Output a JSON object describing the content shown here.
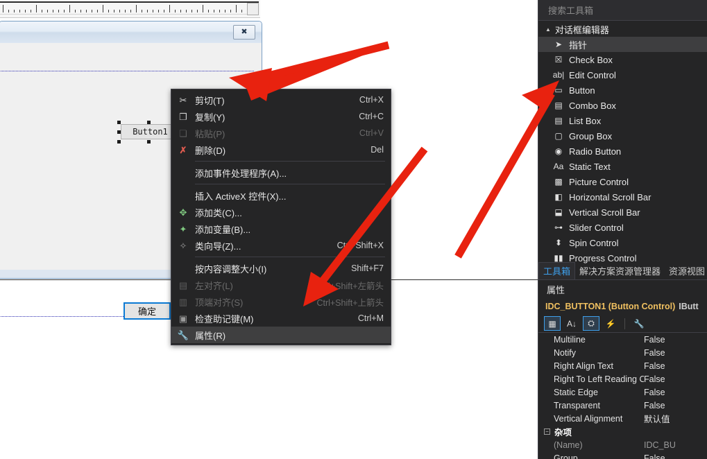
{
  "editor": {
    "dialog_close_glyph": "✖",
    "button1_label": "Button1",
    "ok_label": "确定"
  },
  "context_menu": {
    "items": [
      {
        "icon": "cut-icon",
        "glyph": "✂",
        "label": "剪切(T)",
        "shortcut": "Ctrl+X",
        "state": "normal"
      },
      {
        "icon": "copy-icon",
        "glyph": "❐",
        "label": "复制(Y)",
        "shortcut": "Ctrl+C",
        "state": "normal"
      },
      {
        "icon": "paste-icon",
        "glyph": "❏",
        "label": "粘贴(P)",
        "shortcut": "Ctrl+V",
        "state": "disabled"
      },
      {
        "icon": "delete-icon",
        "glyph": "✗",
        "label": "删除(D)",
        "shortcut": "Del",
        "state": "normal"
      },
      {
        "separator": true
      },
      {
        "icon": "none",
        "glyph": "",
        "label": "添加事件处理程序(A)...",
        "shortcut": "",
        "state": "normal"
      },
      {
        "separator": true
      },
      {
        "icon": "none",
        "glyph": "",
        "label": "插入 ActiveX 控件(X)...",
        "shortcut": "",
        "state": "normal"
      },
      {
        "icon": "add-class-icon",
        "glyph": "✥",
        "label": "添加类(C)...",
        "shortcut": "",
        "state": "normal"
      },
      {
        "icon": "add-variable-icon",
        "glyph": "✦",
        "label": "添加变量(B)...",
        "shortcut": "",
        "state": "normal"
      },
      {
        "icon": "class-wizard-icon",
        "glyph": "✧",
        "label": "类向导(Z)...",
        "shortcut": "Ctrl+Shift+X",
        "state": "normal"
      },
      {
        "separator": true
      },
      {
        "icon": "none",
        "glyph": "",
        "label": "按内容调整大小(I)",
        "shortcut": "Shift+F7",
        "state": "normal"
      },
      {
        "icon": "align-left-icon",
        "glyph": "▤",
        "label": "左对齐(L)",
        "shortcut": "Ctrl+Shift+左箭头",
        "state": "disabled"
      },
      {
        "icon": "align-top-icon",
        "glyph": "▥",
        "label": "顶端对齐(S)",
        "shortcut": "Ctrl+Shift+上箭头",
        "state": "disabled"
      },
      {
        "icon": "check-mnemonic-icon",
        "glyph": "▣",
        "label": "检查助记键(M)",
        "shortcut": "Ctrl+M",
        "state": "normal"
      },
      {
        "icon": "properties-wrench-icon",
        "glyph": "🔧",
        "label": "属性(R)",
        "shortcut": "",
        "state": "highlighted"
      }
    ]
  },
  "toolbox": {
    "search_placeholder": "搜索工具箱",
    "group_label": "对话框编辑器",
    "items": [
      {
        "icon": "pointer-icon",
        "glyph": "➤",
        "label": "指针",
        "selected": true
      },
      {
        "icon": "check-box-icon",
        "glyph": "☒",
        "label": "Check Box",
        "selected": false
      },
      {
        "icon": "edit-control-icon",
        "glyph": "ab|",
        "label": "Edit Control",
        "selected": false
      },
      {
        "icon": "button-icon",
        "glyph": "▭",
        "label": "Button",
        "selected": false
      },
      {
        "icon": "combo-box-icon",
        "glyph": "▤",
        "label": "Combo Box",
        "selected": false
      },
      {
        "icon": "list-box-icon",
        "glyph": "▤",
        "label": "List Box",
        "selected": false
      },
      {
        "icon": "group-box-icon",
        "glyph": "▢",
        "label": "Group Box",
        "selected": false
      },
      {
        "icon": "radio-button-icon",
        "glyph": "◉",
        "label": "Radio Button",
        "selected": false
      },
      {
        "icon": "static-text-icon",
        "glyph": "Aa",
        "label": "Static Text",
        "selected": false
      },
      {
        "icon": "picture-control-icon",
        "glyph": "▩",
        "label": "Picture Control",
        "selected": false
      },
      {
        "icon": "horizontal-scroll-bar-icon",
        "glyph": "◧",
        "label": "Horizontal Scroll Bar",
        "selected": false
      },
      {
        "icon": "vertical-scroll-bar-icon",
        "glyph": "⬓",
        "label": "Vertical Scroll Bar",
        "selected": false
      },
      {
        "icon": "slider-control-icon",
        "glyph": "⊶",
        "label": "Slider Control",
        "selected": false
      },
      {
        "icon": "spin-control-icon",
        "glyph": "⬍",
        "label": "Spin Control",
        "selected": false
      },
      {
        "icon": "progress-control-icon",
        "glyph": "▮▮",
        "label": "Progress Control",
        "selected": false
      }
    ],
    "tabs": [
      {
        "label": "工具箱",
        "active": true
      },
      {
        "label": "解决方案资源管理器",
        "active": false
      },
      {
        "label": "资源视图",
        "active": false
      }
    ]
  },
  "properties": {
    "panel_title": "属性",
    "object_name": "IDC_BUTTON1 (Button Control)",
    "object_type": "IButt",
    "toolbar": [
      {
        "icon": "categorized-icon",
        "glyph": "▦",
        "active": true
      },
      {
        "icon": "alphabetical-icon",
        "glyph": "A↓",
        "active": false
      },
      {
        "icon": "property-pages-icon",
        "glyph": "⛭",
        "active": true
      },
      {
        "icon": "events-icon",
        "glyph": "⚡",
        "active": false
      },
      {
        "icon": "wrench-icon",
        "glyph": "🔧",
        "active": false
      }
    ],
    "rows": [
      {
        "name": "Multiline",
        "value": "False",
        "kind": "prop"
      },
      {
        "name": "Notify",
        "value": "False",
        "kind": "prop"
      },
      {
        "name": "Right Align Text",
        "value": "False",
        "kind": "prop"
      },
      {
        "name": "Right To Left Reading Order",
        "value": "False",
        "kind": "prop"
      },
      {
        "name": "Static Edge",
        "value": "False",
        "kind": "prop"
      },
      {
        "name": "Transparent",
        "value": "False",
        "kind": "prop"
      },
      {
        "name": "Vertical Alignment",
        "value": "默认值",
        "kind": "prop"
      },
      {
        "name": "杂项",
        "value": "",
        "kind": "category"
      },
      {
        "name": "(Name)",
        "value": "IDC_BU",
        "kind": "muted"
      },
      {
        "name": "Group",
        "value": "False",
        "kind": "prop"
      }
    ]
  },
  "colors": {
    "accent_blue": "#3ea0ec",
    "arrow_red": "#e8220f",
    "panel_bg": "#252526",
    "menu_bg": "#252526",
    "dialog_bg": "#f0f0f0"
  }
}
